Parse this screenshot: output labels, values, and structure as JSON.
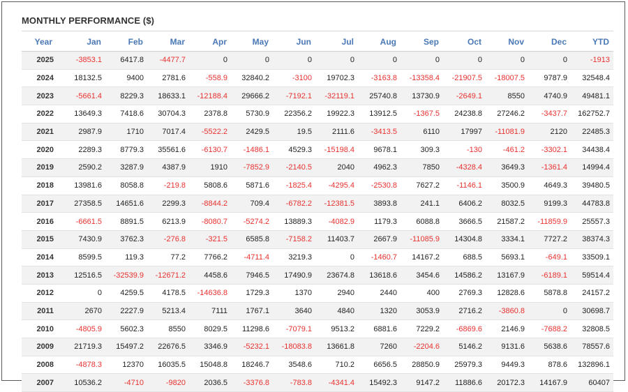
{
  "title": "MONTHLY PERFORMANCE ($)",
  "colors": {
    "header_text": "#4a78b5",
    "negative": "#e8312f",
    "positive": "#222222",
    "row_stripe": "#f2f2f2"
  },
  "columns": [
    "Year",
    "Jan",
    "Feb",
    "Mar",
    "Apr",
    "May",
    "Jun",
    "Jul",
    "Aug",
    "Sep",
    "Oct",
    "Nov",
    "Dec",
    "YTD"
  ],
  "rows": [
    [
      "2025",
      "-3853.1",
      "6417.8",
      "-4477.7",
      "0",
      "0",
      "0",
      "0",
      "0",
      "0",
      "0",
      "0",
      "0",
      "-1913"
    ],
    [
      "2024",
      "18132.5",
      "9400",
      "2781.6",
      "-558.9",
      "32840.2",
      "-3100",
      "19702.3",
      "-3163.8",
      "-13358.4",
      "-21907.5",
      "-18007.5",
      "9787.9",
      "32548.4"
    ],
    [
      "2023",
      "-5661.4",
      "8229.3",
      "18633.1",
      "-12188.4",
      "29666.2",
      "-7192.1",
      "-32119.1",
      "25740.8",
      "13730.9",
      "-2649.1",
      "8550",
      "4740.9",
      "49481.1"
    ],
    [
      "2022",
      "13649.3",
      "7418.6",
      "30704.3",
      "2378.8",
      "5730.9",
      "22356.2",
      "19922.3",
      "13912.5",
      "-1367.5",
      "24238.8",
      "27246.2",
      "-3437.7",
      "162752.7"
    ],
    [
      "2021",
      "2987.9",
      "1710",
      "7017.4",
      "-5522.2",
      "2429.5",
      "19.5",
      "2111.6",
      "-3413.5",
      "6110",
      "17997",
      "-11081.9",
      "2120",
      "22485.3"
    ],
    [
      "2020",
      "2289.3",
      "8779.3",
      "35561.6",
      "-6130.7",
      "-1486.1",
      "4529.3",
      "-15198.4",
      "9678.1",
      "309.3",
      "-130",
      "-461.2",
      "-3302.1",
      "34438.4"
    ],
    [
      "2019",
      "2590.2",
      "3287.9",
      "4387.9",
      "1910",
      "-7852.9",
      "-2140.5",
      "2040",
      "4962.3",
      "7850",
      "-4328.4",
      "3649.3",
      "-1361.4",
      "14994.4"
    ],
    [
      "2018",
      "13981.6",
      "8058.8",
      "-219.8",
      "5808.6",
      "5871.6",
      "-1825.4",
      "-4295.4",
      "-2530.8",
      "7627.2",
      "-1146.1",
      "3500.9",
      "4649.3",
      "39480.5"
    ],
    [
      "2017",
      "27358.5",
      "14651.6",
      "2299.3",
      "-8844.2",
      "709.4",
      "-6782.2",
      "-12381.5",
      "3893.8",
      "241.1",
      "6406.2",
      "8032.5",
      "9199.3",
      "44783.8"
    ],
    [
      "2016",
      "-6661.5",
      "8891.5",
      "6213.9",
      "-8080.7",
      "-5274.2",
      "13889.3",
      "-4082.9",
      "1179.3",
      "6088.8",
      "3666.5",
      "21587.2",
      "-11859.9",
      "25557.3"
    ],
    [
      "2015",
      "7430.9",
      "3762.3",
      "-276.8",
      "-321.5",
      "6585.8",
      "-7158.2",
      "11403.7",
      "2667.9",
      "-11085.9",
      "14304.8",
      "3334.1",
      "7727.2",
      "38374.3"
    ],
    [
      "2014",
      "8599.5",
      "119.3",
      "77.2",
      "7766.2",
      "-4711.4",
      "3219.3",
      "0",
      "-1460.7",
      "14167.2",
      "688.5",
      "5693.1",
      "-649.1",
      "33509.1"
    ],
    [
      "2013",
      "12516.5",
      "-32539.9",
      "-12671.2",
      "4458.6",
      "7946.5",
      "17490.9",
      "23674.8",
      "13618.6",
      "3454.6",
      "14586.2",
      "13167.9",
      "-6189.1",
      "59514.4"
    ],
    [
      "2012",
      "0",
      "4259.5",
      "4178.5",
      "-14636.8",
      "1729.3",
      "1370",
      "2940",
      "2440",
      "400",
      "2769.3",
      "12828.6",
      "5878.8",
      "24157.2"
    ],
    [
      "2011",
      "2670",
      "2227.9",
      "5213.4",
      "7111",
      "1767.1",
      "3640",
      "4840",
      "1320",
      "3053.9",
      "2716.2",
      "-3860.8",
      "0",
      "30698.7"
    ],
    [
      "2010",
      "-4805.9",
      "5602.3",
      "8550",
      "8029.5",
      "11298.6",
      "-7079.1",
      "9513.2",
      "6881.6",
      "7229.2",
      "-6869.6",
      "2146.9",
      "-7688.2",
      "32808.5"
    ],
    [
      "2009",
      "21719.3",
      "15497.2",
      "22676.5",
      "3346.9",
      "-5232.1",
      "-18083.8",
      "13661.8",
      "7260",
      "-2204.6",
      "5146.2",
      "9131.6",
      "5638.6",
      "78557.6"
    ],
    [
      "2008",
      "-4878.3",
      "12370",
      "16035.5",
      "15048.8",
      "18246.7",
      "3548.6",
      "710.2",
      "6656.5",
      "28850.9",
      "25979.3",
      "9449.3",
      "878.6",
      "132896.1"
    ],
    [
      "2007",
      "10536.2",
      "-4710",
      "-9820",
      "2036.5",
      "-3376.8",
      "-783.8",
      "-4341.4",
      "15492.3",
      "9147.2",
      "11886.6",
      "20172.3",
      "14167.9",
      "60407"
    ]
  ]
}
